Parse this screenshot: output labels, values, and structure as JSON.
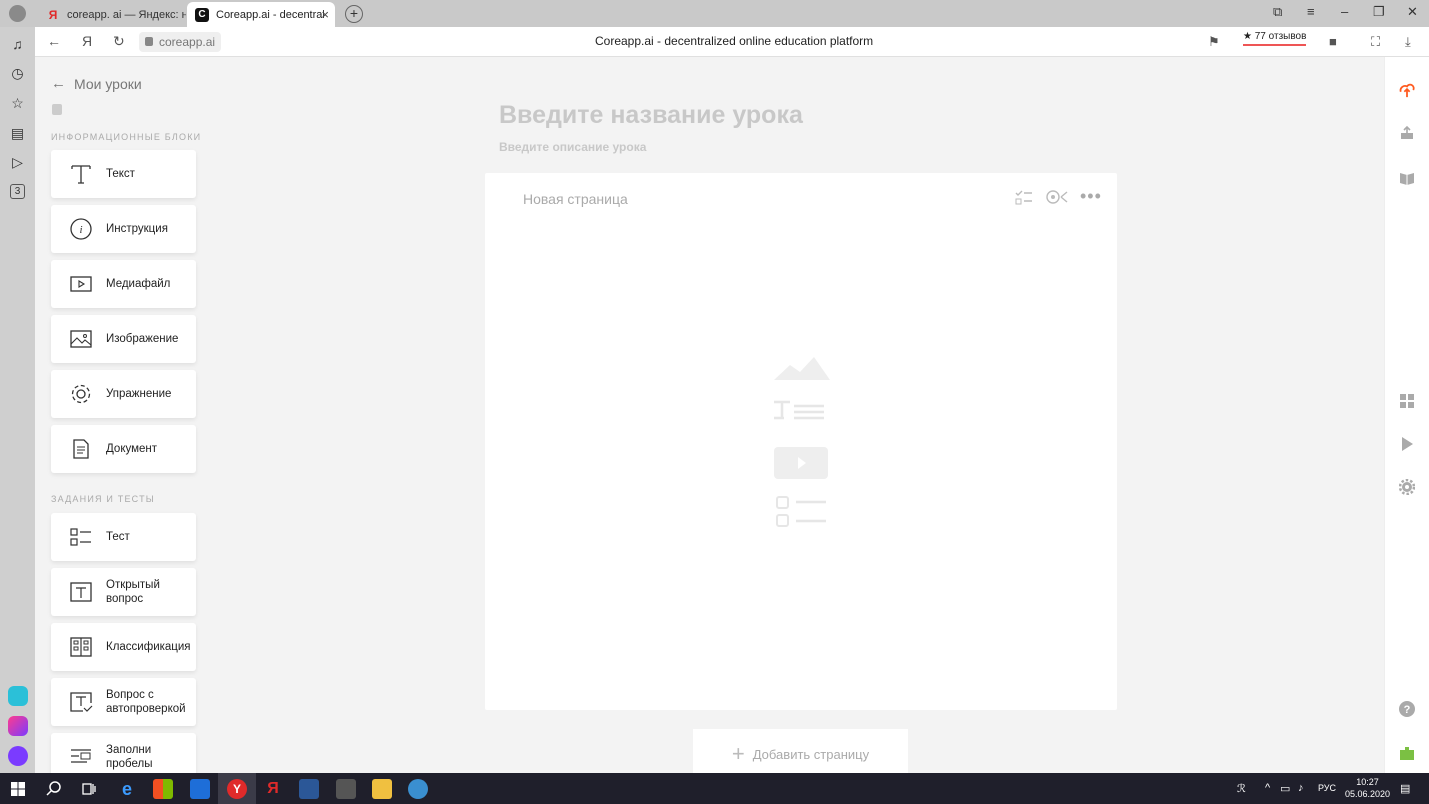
{
  "browser": {
    "tabs": [
      {
        "label": "coreapp. ai — Яндекс: нашл",
        "active": false,
        "favicon": "Я"
      },
      {
        "label": "Coreapp.ai - decentralize",
        "active": true,
        "favicon": "C"
      }
    ],
    "url": "coreapp.ai",
    "page_title": "Coreapp.ai - decentralized online education platform",
    "reviews": "★ 77 отзывов",
    "nav_back": "←",
    "nav_yandex": "Я",
    "nav_reload": "↻"
  },
  "editor": {
    "back_label": "Мои уроки",
    "info_section_label": "ИНФОРМАЦИОННЫЕ БЛОКИ",
    "info_blocks": [
      {
        "label": "Текст",
        "icon": "text-icon"
      },
      {
        "label": "Инструкция",
        "icon": "info-icon"
      },
      {
        "label": "Медиафайл",
        "icon": "media-icon"
      },
      {
        "label": "Изображение",
        "icon": "image-icon"
      },
      {
        "label": "Упражнение",
        "icon": "gear-icon"
      },
      {
        "label": "Документ",
        "icon": "document-icon"
      }
    ],
    "tasks_section_label": "ЗАДАНИЯ И ТЕСТЫ",
    "task_blocks": [
      {
        "label": "Тест",
        "icon": "test-icon"
      },
      {
        "label": "Открытый вопрос",
        "icon": "open-question-icon"
      },
      {
        "label": "Классификация",
        "icon": "classification-icon"
      },
      {
        "label": "Вопрос с автопроверкой",
        "icon": "autocheck-icon"
      },
      {
        "label": "Заполни пробелы",
        "icon": "fill-gaps-icon"
      }
    ],
    "lesson_title_placeholder": "Введите название урока",
    "lesson_desc_placeholder": "Введите описание урока",
    "page_name": "Новая страница",
    "add_page_label": "Добавить страницу"
  },
  "taskbar": {
    "lang": "РУС",
    "time": "10:27",
    "date": "05.06.2020"
  },
  "colors": {
    "accent_orange": "#ff5a1f",
    "placeholder_gray": "#c8c8c8",
    "taskbar": "#1f1f2b"
  }
}
